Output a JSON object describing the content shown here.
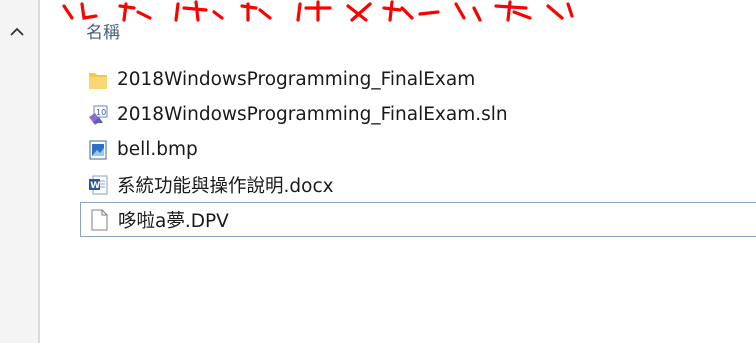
{
  "annotation": {
    "icon": "red-handwritten-annotation",
    "color": "#ff0000"
  },
  "nav_pane": {
    "collapse_icon": "chevron-up-icon"
  },
  "header": {
    "name_column": "名稱"
  },
  "files": [
    {
      "name": "2018WindowsProgramming_FinalExam",
      "icon": "folder-icon"
    },
    {
      "name": "2018WindowsProgramming_FinalExam.sln",
      "icon": "visual-studio-solution-icon"
    },
    {
      "name": "bell.bmp",
      "icon": "bitmap-image-icon"
    },
    {
      "name": "系統功能與操作說明.docx",
      "icon": "word-document-icon"
    },
    {
      "name": "哆啦a夢.DPV",
      "icon": "blank-file-icon",
      "focused": true
    }
  ]
}
